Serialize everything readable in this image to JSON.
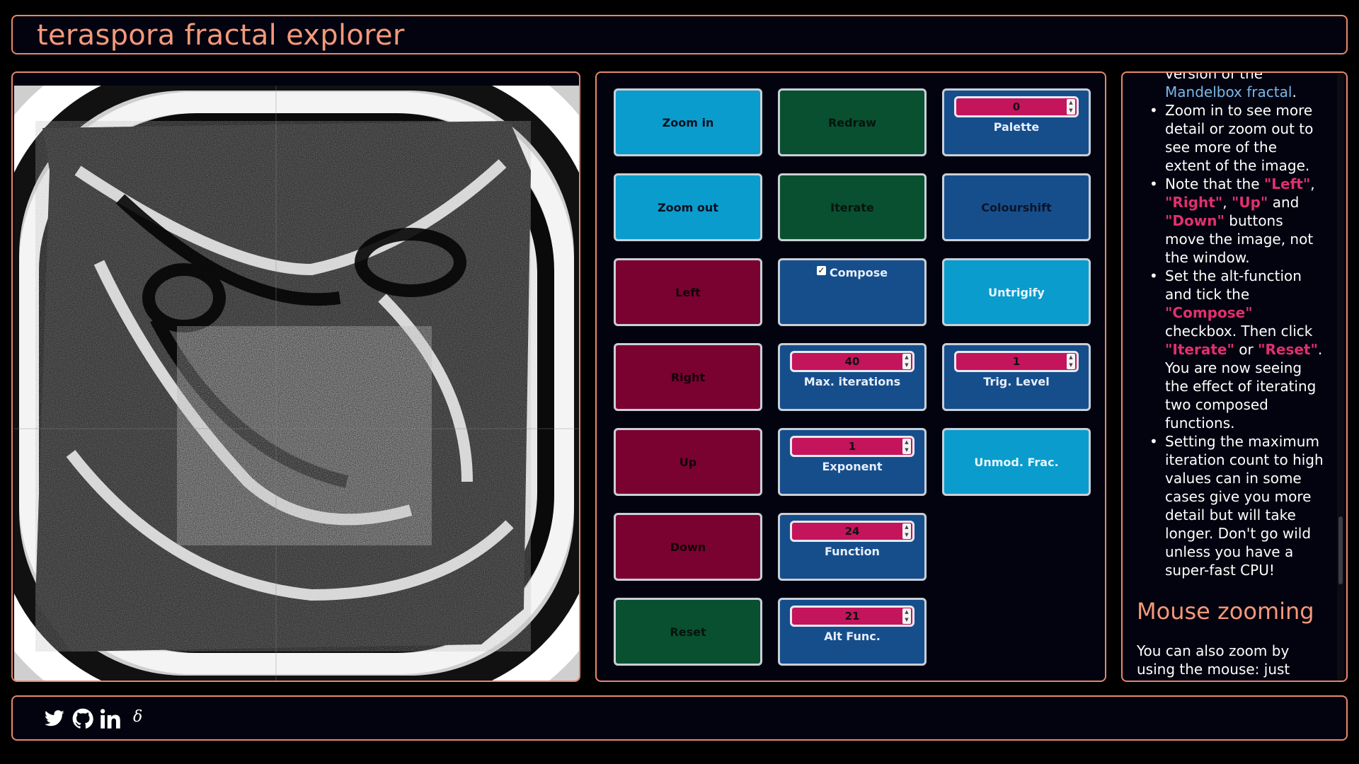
{
  "header": {
    "title": "teraspora fractal explorer"
  },
  "controls": {
    "zoom_in": "Zoom in",
    "zoom_out": "Zoom out",
    "left": "Left",
    "right": "Right",
    "up": "Up",
    "down": "Down",
    "reset": "Reset",
    "redraw": "Redraw",
    "iterate": "Iterate",
    "compose": "Compose",
    "compose_checked": true,
    "max_iterations": {
      "label": "Max. iterations",
      "value": "40"
    },
    "exponent": {
      "label": "Exponent",
      "value": "1"
    },
    "function": {
      "label": "Function",
      "value": "24"
    },
    "alt_func": {
      "label": "Alt Func.",
      "value": "21"
    },
    "palette": {
      "label": "Palette",
      "value": "0"
    },
    "colourshift": "Colourshift",
    "untrigify": "Untrigify",
    "trig_level": {
      "label": "Trig. Level",
      "value": "1"
    },
    "unmod_frac": "Unmod. Frac."
  },
  "info": {
    "cut_top": "version of the",
    "mandelbox_link": "Mandelbox fractal",
    "period": ".",
    "zoom_tip": "Zoom in to see more detail or zoom out to see more of the extent of the image.",
    "note_prefix": "Note that the ",
    "left_q": "\"Left\"",
    "comma1": ", ",
    "right_q": "\"Right\"",
    "comma2": ", ",
    "up_q": "\"Up\"",
    "and1": " and ",
    "down_q": "\"Down\"",
    "note_suffix": " buttons move the image, not the window.",
    "alt_prefix": "Set the alt-function and tick the ",
    "compose_q": "\"Compose\"",
    "alt_mid": " checkbox. Then click ",
    "iterate_q": "\"Iterate\"",
    "or": " or ",
    "reset_q": "\"Reset\"",
    "alt_suffix": ". You are now seeing the effect of iterating two composed functions.",
    "max_tip": "Setting the maximum iteration count to high values can in some cases give you more detail but will take longer. Don't go wild unless you have a super-fast CPU!",
    "mouse_heading": "Mouse zooming",
    "mouse_text": "You can also zoom by using the mouse: just"
  },
  "footer": {
    "icons": [
      "twitter-icon",
      "github-icon",
      "linkedin-icon",
      "sigma-icon"
    ],
    "sigma_glyph": "𝛿"
  },
  "colors": {
    "accent": "#e8876b",
    "cyan": "#0a9ccc",
    "green": "#085030",
    "red": "#7a0230",
    "blue": "#164e8c",
    "magenta": "#c4145c",
    "highlight": "#e0306e"
  }
}
